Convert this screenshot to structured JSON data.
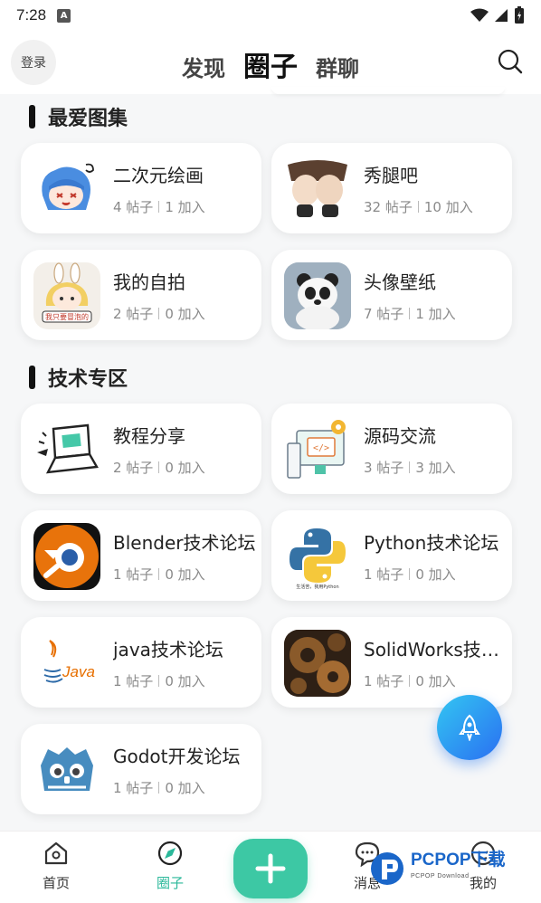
{
  "status": {
    "time": "7:28",
    "notif": "A"
  },
  "header": {
    "login": "登录",
    "tabs": [
      "发现",
      "圈子",
      "群聊"
    ]
  },
  "sections": {
    "favorites": {
      "title": "最爱图集",
      "cards": [
        {
          "name": "二次元绘画",
          "posts": "4 帖子",
          "joins": "1 加入"
        },
        {
          "name": "秀腿吧",
          "posts": "32 帖子",
          "joins": "10 加入"
        },
        {
          "name": "我的自拍",
          "posts": "2 帖子",
          "joins": "0 加入"
        },
        {
          "name": "头像壁纸",
          "posts": "7 帖子",
          "joins": "1 加入"
        }
      ]
    },
    "tech": {
      "title": "技术专区",
      "cards": [
        {
          "name": "教程分享",
          "posts": "2 帖子",
          "joins": "0 加入"
        },
        {
          "name": "源码交流",
          "posts": "3 帖子",
          "joins": "3 加入"
        },
        {
          "name": "Blender技术论坛",
          "posts": "1 帖子",
          "joins": "0 加入"
        },
        {
          "name": "Python技术论坛",
          "posts": "1 帖子",
          "joins": "0 加入"
        },
        {
          "name": "java技术论坛",
          "posts": "1 帖子",
          "joins": "0 加入"
        },
        {
          "name": "SolidWorks技术论坛",
          "posts": "1 帖子",
          "joins": "0 加入"
        },
        {
          "name": "Godot开发论坛",
          "posts": "1 帖子",
          "joins": "0 加入"
        }
      ]
    }
  },
  "thumb_texts": {
    "java": "Java",
    "selfie_sticker": "我只要冒泡的",
    "python_caption": "生活苦，我用Python"
  },
  "nav": {
    "home": "首页",
    "circle": "圈子",
    "messages": "消息",
    "me": "我的"
  },
  "watermark": {
    "brand": "PCPOP下载",
    "sub": "PCPOP Download"
  },
  "colors": {
    "accent": "#3dc8a4",
    "active_nav": "#2bb89a",
    "fab_from": "#33c6f2",
    "fab_to": "#2a6ff2"
  }
}
